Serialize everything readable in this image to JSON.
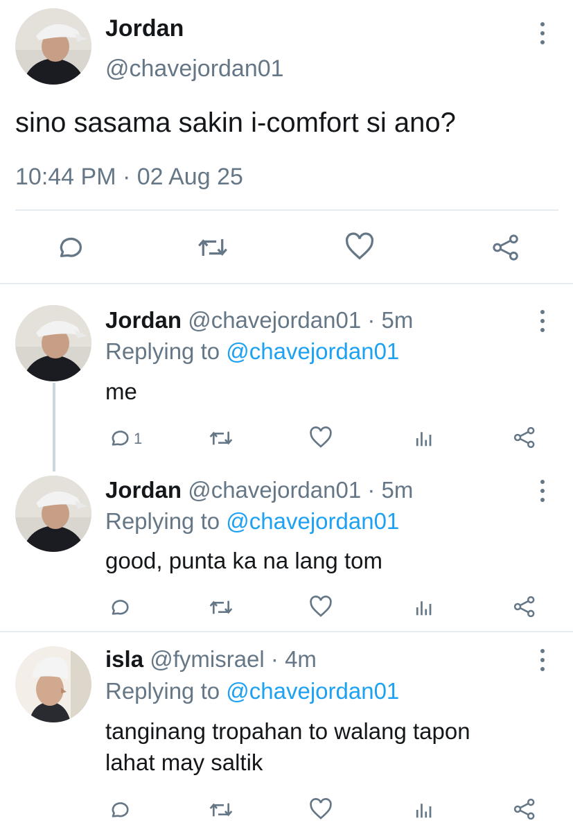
{
  "main_tweet": {
    "author_name": "Jordan",
    "handle": "@chavejordan01",
    "text": "sino sasama sakin i-comfort si ano?",
    "timestamp": "10:44 PM · 02 Aug 25",
    "actions": [
      "reply-icon",
      "retweet-icon",
      "like-icon",
      "share-icon"
    ]
  },
  "replies": [
    {
      "author_name": "Jordan",
      "handle": "@chavejordan01",
      "age": "· 5m",
      "replying_prefix": "Replying to",
      "replying_handle": "@chavejordan01",
      "text_lines": [
        "me"
      ],
      "reply_count": "1"
    },
    {
      "author_name": "Jordan",
      "handle": "@chavejordan01",
      "age": "· 5m",
      "replying_prefix": "Replying to",
      "replying_handle": "@chavejordan01",
      "text_lines": [
        "good, punta ka na lang tom"
      ],
      "reply_count": ""
    },
    {
      "author_name": "isla",
      "handle": "@fymisrael",
      "age": "· 4m",
      "replying_prefix": "Replying to",
      "replying_handle": "@chavejordan01",
      "text_lines": [
        "tanginang tropahan to walang tapon",
        "lahat may saltik"
      ],
      "reply_count": ""
    }
  ],
  "colors": {
    "link": "#1da1f2",
    "muted": "#657786",
    "text": "#14171a",
    "divider": "#e6ecf0"
  }
}
